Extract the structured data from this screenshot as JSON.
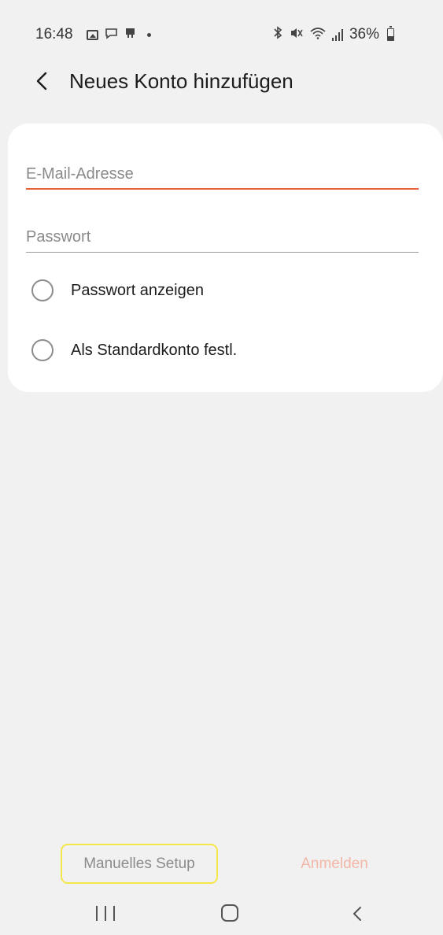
{
  "status_bar": {
    "time": "16:48",
    "left_icons": [
      "gallery-icon",
      "chat-bubble-icon",
      "notification-icon",
      "dot-icon"
    ],
    "right_icons": [
      "bluetooth-icon",
      "mute-icon",
      "wifi-icon",
      "signal-icon",
      "battery-icon"
    ],
    "battery_percent": "36%"
  },
  "header": {
    "title": "Neues Konto hinzufügen",
    "back_icon": "chevron-left-icon"
  },
  "form": {
    "email": {
      "placeholder": "E-Mail-Adresse",
      "value": ""
    },
    "password": {
      "placeholder": "Passwort",
      "value": ""
    },
    "show_password_label": "Passwort anzeigen",
    "set_default_label": "Als Standardkonto festl."
  },
  "actions": {
    "manual_setup_label": "Manuelles Setup",
    "login_label": "Anmelden"
  },
  "nav_bar": {
    "icons": [
      "recents-icon",
      "home-icon",
      "back-icon"
    ]
  },
  "colors": {
    "background": "#f1f1f1",
    "card": "#ffffff",
    "accent": "#e8603c",
    "login_disabled": "#f2b7a6",
    "highlight_outline": "#f5e64a"
  }
}
